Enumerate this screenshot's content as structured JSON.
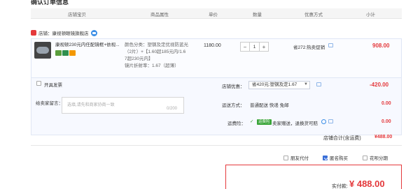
{
  "section_title": "确认订单信息",
  "columns": [
    "店铺宝贝",
    "商品属性",
    "单价",
    "数量",
    "优惠方式",
    "小计"
  ],
  "shop": {
    "label": "店铺：康视顿眼镜旗舰店"
  },
  "item": {
    "name": "康视顿230元内任配镜框+依视...",
    "attr_lines": [
      "颜色分类：塑钢及定优视防蓝光",
      "（2片）+【1.60超185元内/1.6",
      "7超230元内】",
      "镜片折射率：1.67（超薄）"
    ],
    "price": "1180.00",
    "quantity": "1",
    "promo": "省272:热卖促销",
    "subtotal": "908.00",
    "badge_colors": [
      "#5a9e3c",
      "#2f8f4e",
      "#f39800"
    ]
  },
  "invoice": {
    "label": "开具发票"
  },
  "message": {
    "label": "给卖家留言：",
    "placeholder": "选填,请先和商家协商一致",
    "count": "0/200"
  },
  "coupon": {
    "label": "店铺优惠：",
    "selected": "省420元:塑钢及定1.67",
    "amount": "-420.00"
  },
  "shipping": {
    "label": "运送方式：",
    "value": "普通配送 快递 免邮",
    "amount": "0.00"
  },
  "insurance": {
    "label": "运费险：",
    "tag": "运费险",
    "text": "卖家赠送，退换货可赔",
    "amount": "0.00"
  },
  "shop_total": {
    "label": "店铺合计(含运费)",
    "amount": "¥488.00"
  },
  "footer_options": [
    {
      "label": "朋友代付",
      "checked": false
    },
    {
      "label": "匿名购买",
      "checked": true
    },
    {
      "label": "花呗分期",
      "checked": false
    }
  ],
  "payment": {
    "label": "实付款:",
    "amount": "¥ 488.00"
  }
}
